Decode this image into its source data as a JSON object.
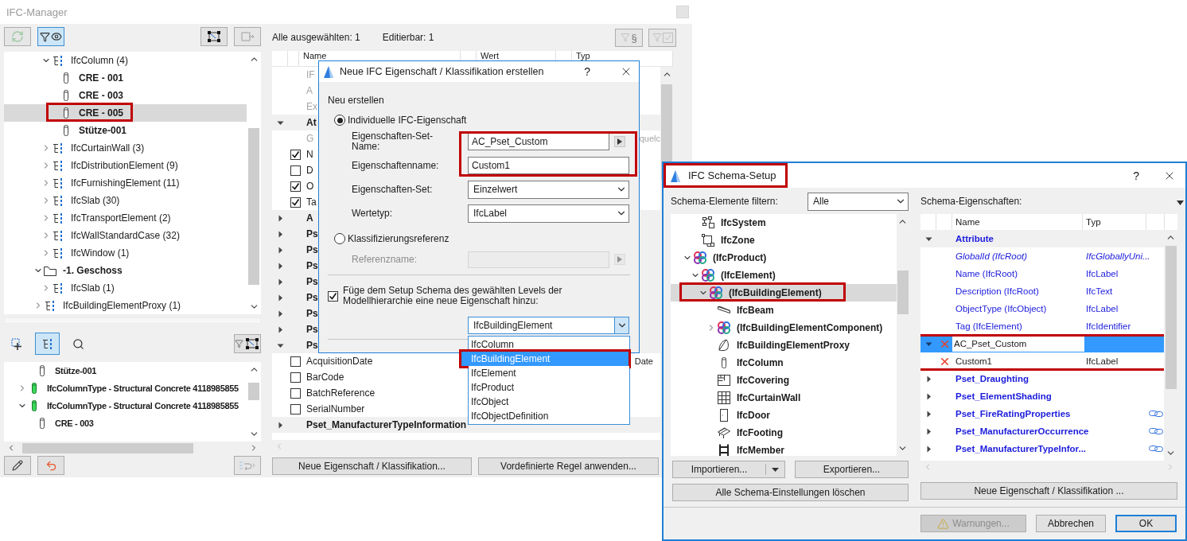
{
  "ifc_manager": {
    "title": "IFC-Manager",
    "top_toolbar": [
      {
        "on": false,
        "disabled": true
      },
      {
        "on": true,
        "disabled": false
      },
      {
        "on": false,
        "disabled": false
      },
      {
        "on": false,
        "disabled": true
      }
    ],
    "model_tree": [
      {
        "children": [
          {
            "kind": "class",
            "label": "IfcColumn (4)",
            "expanded": true,
            "selected": false,
            "children": [
              {
                "kind": "element",
                "label": "CRE - 001",
                "selected": false,
                "highlighted": false
              },
              {
                "kind": "element",
                "label": "CRE - 003",
                "selected": false,
                "highlighted": false
              },
              {
                "kind": "element",
                "label": "CRE - 005",
                "selected": true,
                "highlighted": true
              },
              {
                "kind": "element",
                "label": "Stütze-001",
                "selected": false,
                "highlighted": false
              }
            ]
          },
          {
            "kind": "class",
            "label": "IfcCurtainWall (3)",
            "expanded": false,
            "selected": false
          },
          {
            "kind": "class",
            "label": "IfcDistributionElement (9)",
            "expanded": false,
            "selected": false
          },
          {
            "kind": "class",
            "label": "IfcFurnishingElement (11)",
            "expanded": false,
            "selected": false
          },
          {
            "kind": "class",
            "label": "IfcSlab (30)",
            "expanded": false,
            "selected": false
          },
          {
            "kind": "class",
            "label": "IfcTransportElement (2)",
            "expanded": false,
            "selected": false
          },
          {
            "kind": "class",
            "label": "IfcWallStandardCase (32)",
            "expanded": false,
            "selected": false
          },
          {
            "kind": "class",
            "label": "IfcWindow (1)",
            "expanded": false,
            "selected": false
          }
        ]
      },
      {
        "kind": "storey",
        "label": "-1. Geschoss",
        "expanded": true,
        "selected": false,
        "children": [
          {
            "kind": "class",
            "label": "IfcSlab (1)",
            "expanded": false,
            "selected": false
          }
        ]
      },
      {
        "kind": "class",
        "label": "IfcBuildingElementProxy (1)",
        "expanded": false,
        "selected": false
      }
    ],
    "view_toolbar": [
      {
        "on": false
      },
      {
        "on": true
      },
      {
        "on": false
      },
      {
        "on": false
      }
    ],
    "type_tree": [
      {
        "children": [
          {
            "kind": "element",
            "label": "Stütze-001",
            "selected": false
          }
        ]
      },
      {
        "kind": "type",
        "label": "IfcColumnType - Structural Concrete 4118985855",
        "expanded": false,
        "selected": false
      },
      {
        "kind": "type",
        "label": "IfcColumnType - Structural Concrete 4118985855",
        "expanded": true,
        "selected": false,
        "children": [
          {
            "kind": "element",
            "label": "CRE - 003",
            "selected": false
          }
        ]
      }
    ],
    "bottom_toolbar": [
      {
        "disabled": false
      },
      {
        "disabled": false
      },
      {
        "disabled": true
      }
    ],
    "selection_summary": "Alle ausgewählten: 1",
    "editable_summary": "Editierbar: 1",
    "filter_buttons": [
      {
        "glyph": "§",
        "disabled": true
      },
      {
        "disabled": true
      }
    ],
    "property_table": {
      "columns": [
        "Name",
        "Wert",
        "Typ"
      ],
      "rows": [
        {
          "kind": "attribute",
          "name": "IF"
        },
        {
          "kind": "attribute",
          "name": "A"
        },
        {
          "kind": "attribute",
          "name": "Ex"
        },
        {
          "kind": "group",
          "name": "At",
          "expanded": true
        },
        {
          "kind": "attribute",
          "name": "G",
          "value": "quelc"
        },
        {
          "kind": "property",
          "name": "N",
          "checked": true
        },
        {
          "kind": "property",
          "name": "D",
          "checked": false
        },
        {
          "kind": "property",
          "name": "O",
          "checked": true
        },
        {
          "kind": "property",
          "name": "Ta",
          "checked": true
        },
        {
          "kind": "group",
          "name": "A",
          "expanded": false
        },
        {
          "kind": "group",
          "name": "Ps",
          "expanded": false
        },
        {
          "kind": "group",
          "name": "Ps",
          "expanded": false
        },
        {
          "kind": "group",
          "name": "Ps",
          "expanded": false
        },
        {
          "kind": "group",
          "name": "Ps",
          "expanded": false
        },
        {
          "kind": "group",
          "name": "Ps",
          "expanded": false
        },
        {
          "kind": "group",
          "name": "Ps",
          "expanded": false
        },
        {
          "kind": "group",
          "name": "Ps",
          "expanded": false
        },
        {
          "kind": "group",
          "name": "Ps",
          "expanded": true
        },
        {
          "kind": "property",
          "name": "AcquisitionDate",
          "checked": false,
          "type": "Date"
        },
        {
          "kind": "property",
          "name": "BarCode",
          "checked": false
        },
        {
          "kind": "property",
          "name": "BatchReference",
          "checked": false
        },
        {
          "kind": "property",
          "name": "SerialNumber",
          "checked": false
        },
        {
          "kind": "group",
          "name": "Pset_ManufacturerTypeInformation",
          "expanded": false
        }
      ]
    },
    "buttons": [
      "Neue Eigenschaft / Klassifikation...",
      "Vordefinierte Regel anwenden..."
    ]
  },
  "new_property_dialog": {
    "title": "Neue IFC Eigenschaft / Klassifikation erstellen",
    "help": "?",
    "section": "Neu erstellen",
    "options": [
      {
        "label": "Individuelle IFC-Eigenschaft",
        "selected": true,
        "fields": [
          {
            "kind": "browse",
            "label": "Eigenschaften-Set-Name:",
            "value": "AC_Pset_Custom",
            "disabled": false,
            "highlighted": true
          },
          {
            "kind": "text",
            "label": "Eigenschaftenname:",
            "value": "Custom1",
            "disabled": false,
            "highlighted": true
          },
          {
            "kind": "select",
            "label": "Eigenschaften-Set:",
            "value": "Einzelwert",
            "disabled": false,
            "highlighted": false
          },
          {
            "kind": "select",
            "label": "Wertetyp:",
            "value": "IfcLabel",
            "disabled": false,
            "highlighted": false
          }
        ]
      },
      {
        "label": "Klassifizierungsreferenz",
        "selected": false,
        "fields": [
          {
            "kind": "browse",
            "label": "Referenzname:",
            "disabled": true,
            "highlighted": false
          }
        ]
      }
    ],
    "add_to_schema": {
      "label": "Füge dem Setup Schema des gewählten Levels der Modellhierarchie eine neue Eigenschaft hinzu:",
      "checked": true
    },
    "level": {
      "value": "IfcBuildingElement",
      "expanded": true,
      "options": [
        {
          "label": "IfcColumn",
          "selected": false,
          "highlighted": false
        },
        {
          "label": "IfcBuildingElement",
          "selected": true,
          "highlighted": true
        },
        {
          "label": "IfcElement",
          "selected": false,
          "highlighted": false
        },
        {
          "label": "IfcProduct",
          "selected": false,
          "highlighted": false
        },
        {
          "label": "IfcObject",
          "selected": false,
          "highlighted": false
        },
        {
          "label": "IfcObjectDefinition",
          "selected": false,
          "highlighted": false
        }
      ]
    }
  },
  "schema_setup": {
    "title": "IFC Schema-Setup",
    "title_highlighted": true,
    "help": "?",
    "filter_label": "Schema-Elemente filtern:",
    "filter_value": "Alle",
    "tree": [
      {
        "children": [
          {
            "kind": "system",
            "label": "IfcSystem",
            "selected": false
          },
          {
            "kind": "zone",
            "label": "IfcZone",
            "selected": false
          }
        ]
      },
      {
        "kind": "abstract",
        "label": "(IfcProduct)",
        "expanded": true,
        "selected": false,
        "children": [
          {
            "kind": "abstract",
            "label": "(IfcElement)",
            "expanded": true,
            "selected": false,
            "children": [
              {
                "kind": "abstract",
                "label": "(IfcBuildingElement)",
                "expanded": true,
                "selected": true,
                "highlighted": true,
                "children": [
                  {
                    "kind": "beam",
                    "label": "IfcBeam",
                    "selected": false
                  },
                  {
                    "kind": "abstract",
                    "label": "(IfcBuildingElementComponent)",
                    "expanded": false,
                    "selected": false
                  },
                  {
                    "kind": "proxy",
                    "label": "IfcBuildingElementProxy",
                    "selected": false
                  },
                  {
                    "kind": "column",
                    "label": "IfcColumn",
                    "selected": false
                  },
                  {
                    "kind": "covering",
                    "label": "IfcCovering",
                    "selected": false
                  },
                  {
                    "kind": "curtainwall",
                    "label": "IfcCurtainWall",
                    "selected": false
                  },
                  {
                    "kind": "door",
                    "label": "IfcDoor",
                    "selected": false
                  },
                  {
                    "kind": "footing",
                    "label": "IfcFooting",
                    "selected": false
                  },
                  {
                    "kind": "member",
                    "label": "IfcMember",
                    "selected": false
                  }
                ]
              }
            ]
          }
        ]
      }
    ],
    "import_button": "Importieren...",
    "export_button": "Exportieren...",
    "clear_button": "Alle Schema-Einstellungen löschen",
    "properties_label": "Schema-Eigenschaften:",
    "columns": [
      "Name",
      "Typ"
    ],
    "rows": [
      {
        "kind": "group",
        "name": "Attribute",
        "expanded": true,
        "linked": false,
        "selected": false,
        "highlighted": false
      },
      {
        "kind": "attribute",
        "name": "GlobalId (IfcRoot)",
        "type": "IfcGloballyUni...",
        "read_only": true,
        "selected": false,
        "highlighted": false
      },
      {
        "kind": "attribute",
        "name": "Name (IfcRoot)",
        "type": "IfcLabel",
        "read_only": false,
        "selected": false,
        "highlighted": false
      },
      {
        "kind": "attribute",
        "name": "Description (IfcRoot)",
        "type": "IfcText",
        "read_only": false,
        "selected": false,
        "highlighted": false
      },
      {
        "kind": "attribute",
        "name": "ObjectType (IfcObject)",
        "type": "IfcLabel",
        "read_only": false,
        "selected": false,
        "highlighted": false
      },
      {
        "kind": "attribute",
        "name": "Tag (IfcElement)",
        "type": "IfcIdentifier",
        "read_only": false,
        "selected": false,
        "highlighted": false
      },
      {
        "kind": "custom_group",
        "name": "AC_Pset_Custom",
        "expanded": true,
        "editing": true,
        "selected": true,
        "highlighted": true
      },
      {
        "kind": "custom",
        "name": "Custom1",
        "type": "IfcLabel",
        "selected": false,
        "highlighted": true
      },
      {
        "kind": "group",
        "name": "Pset_Draughting",
        "expanded": false,
        "linked": false,
        "selected": false,
        "highlighted": false
      },
      {
        "kind": "group",
        "name": "Pset_ElementShading",
        "expanded": false,
        "linked": false,
        "selected": false,
        "highlighted": false
      },
      {
        "kind": "group",
        "name": "Pset_FireRatingProperties",
        "expanded": false,
        "linked": true,
        "selected": false,
        "highlighted": false
      },
      {
        "kind": "group",
        "name": "Pset_ManufacturerOccurrence",
        "expanded": false,
        "linked": true,
        "selected": false,
        "highlighted": false
      },
      {
        "kind": "group",
        "name": "Pset_ManufacturerTypeInfor...",
        "expanded": false,
        "linked": true,
        "selected": false,
        "highlighted": false
      }
    ],
    "new_button": "Neue Eigenschaft / Klassifikation ...",
    "warnings_button": {
      "label": "Warnungen...",
      "disabled": true
    },
    "cancel_button": "Abbrechen",
    "ok_button": "OK"
  }
}
